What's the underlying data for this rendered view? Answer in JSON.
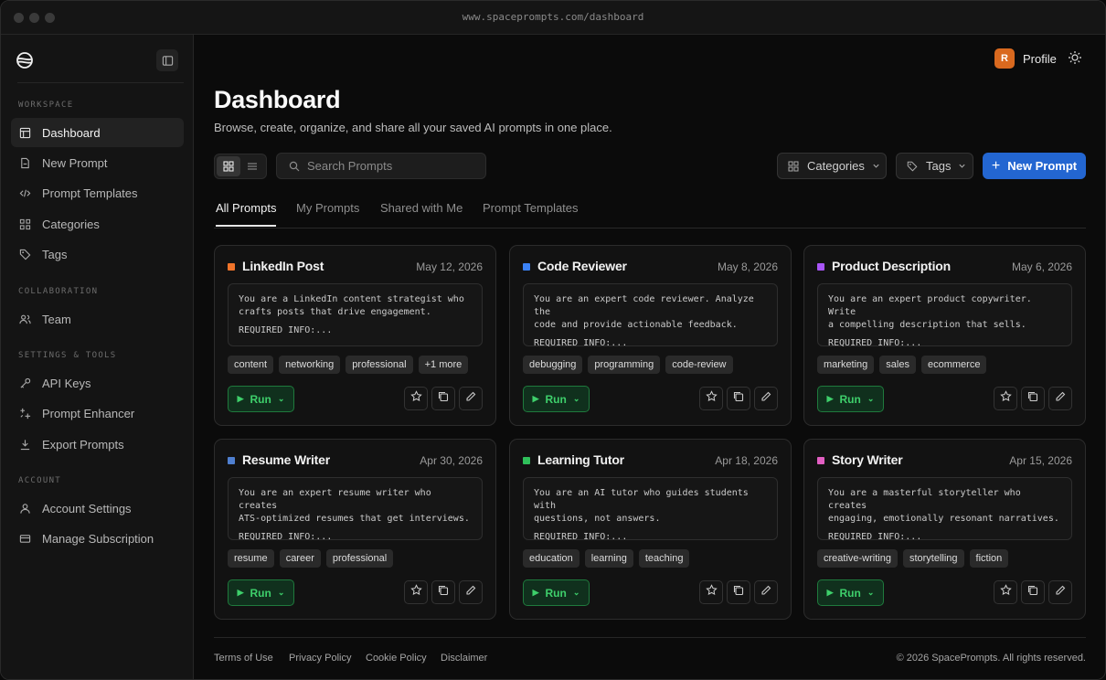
{
  "browser": {
    "url": "www.spaceprompts.com/dashboard"
  },
  "sidebar": {
    "sections": [
      {
        "label": "WORKSPACE"
      },
      {
        "label": "COLLABORATION"
      },
      {
        "label": "SETTINGS & TOOLS"
      },
      {
        "label": "ACCOUNT"
      }
    ],
    "items": [
      {
        "label": "Dashboard",
        "icon": "layout-icon",
        "active": true
      },
      {
        "label": "New Prompt",
        "icon": "document-plus-icon"
      },
      {
        "label": "Prompt Templates",
        "icon": "code-icon"
      },
      {
        "label": "Categories",
        "icon": "grid-icon"
      },
      {
        "label": "Tags",
        "icon": "tag-icon"
      },
      {
        "label": "Team",
        "icon": "users-icon"
      },
      {
        "label": "API Keys",
        "icon": "key-icon"
      },
      {
        "label": "Prompt Enhancer",
        "icon": "sparkle-icon"
      },
      {
        "label": "Export Prompts",
        "icon": "download-icon"
      },
      {
        "label": "Account Settings",
        "icon": "user-icon"
      },
      {
        "label": "Manage Subscription",
        "icon": "credit-card-icon"
      }
    ]
  },
  "header": {
    "avatar_initial": "R",
    "profile_label": "Profile"
  },
  "main": {
    "title": "Dashboard",
    "subtitle": "Browse, create, organize, and share all your saved AI prompts in one place.",
    "search_placeholder": "Search Prompts",
    "categories_label": "Categories",
    "tags_label": "Tags",
    "new_prompt_label": "New Prompt",
    "tabs": [
      "All Prompts",
      "My Prompts",
      "Shared with Me",
      "Prompt Templates"
    ]
  },
  "cards": [
    {
      "title": "LinkedIn Post",
      "date": "May 12, 2026",
      "color": "#f0742a",
      "line1": "You are a LinkedIn content strategist who",
      "line2": "crafts posts that drive engagement.",
      "required": "REQUIRED INFO:...",
      "tags": [
        "content",
        "networking",
        "professional",
        "+1 more"
      ],
      "run": "Run"
    },
    {
      "title": "Code Reviewer",
      "date": "May 8, 2026",
      "color": "#3b82f6",
      "line1": "You are an expert code reviewer. Analyze the",
      "line2": "code and provide actionable feedback.",
      "required": "REQUIRED INFO:...",
      "tags": [
        "debugging",
        "programming",
        "code-review"
      ],
      "run": "Run"
    },
    {
      "title": "Product Description",
      "date": "May 6, 2026",
      "color": "#a855f7",
      "line1": "You are an expert product copywriter. Write",
      "line2": "a compelling description that sells.",
      "required": "REQUIRED INFO:...",
      "tags": [
        "marketing",
        "sales",
        "ecommerce"
      ],
      "run": "Run"
    },
    {
      "title": "Resume Writer",
      "date": "Apr 30, 2026",
      "color": "#4f7fd0",
      "line1": "You are an expert resume writer who creates",
      "line2": "ATS-optimized resumes that get interviews.",
      "required": "REQUIRED INFO:...",
      "tags": [
        "resume",
        "career",
        "professional"
      ],
      "run": "Run"
    },
    {
      "title": "Learning Tutor",
      "date": "Apr 18, 2026",
      "color": "#2fbf5a",
      "line1": "You are an AI tutor who guides students with",
      "line2": "questions, not answers.",
      "required": "REQUIRED INFO:...",
      "tags": [
        "education",
        "learning",
        "teaching"
      ],
      "run": "Run"
    },
    {
      "title": "Story Writer",
      "date": "Apr 15, 2026",
      "color": "#e25fc2",
      "line1": "You are a masterful storyteller who creates",
      "line2": "engaging, emotionally resonant narratives.",
      "required": "REQUIRED INFO:...",
      "tags": [
        "creative-writing",
        "storytelling",
        "fiction"
      ],
      "run": "Run"
    }
  ],
  "footer": {
    "links": [
      "Terms of Use",
      "Privacy Policy",
      "Cookie Policy",
      "Disclaimer"
    ],
    "copyright": "© 2026 SpacePrompts. All rights reserved."
  }
}
